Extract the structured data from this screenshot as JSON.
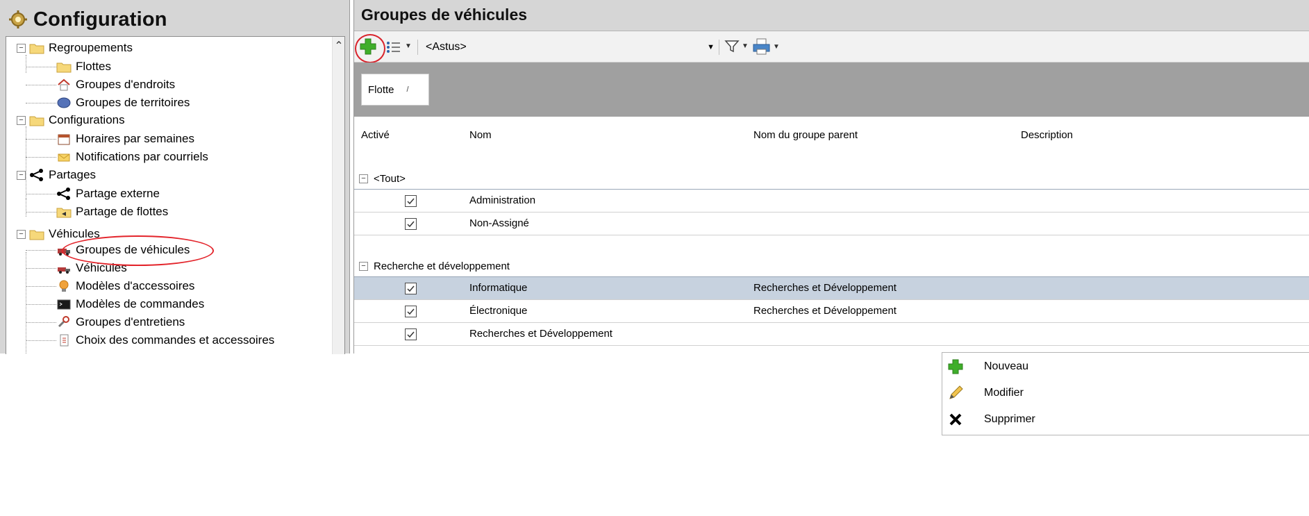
{
  "left": {
    "title": "Configuration",
    "tree": [
      {
        "label": "Regroupements",
        "icon": "folder-icon"
      },
      {
        "label": "Flottes",
        "icon": "folder-icon"
      },
      {
        "label": "Groupes d'endroits",
        "icon": "house-icon"
      },
      {
        "label": "Groupes de territoires",
        "icon": "territory-icon"
      },
      {
        "label": "Configurations",
        "icon": "folder-icon"
      },
      {
        "label": "Horaires par semaines",
        "icon": "calendar-icon"
      },
      {
        "label": "Notifications par courriels",
        "icon": "envelope-icon"
      },
      {
        "label": "Partages",
        "icon": "share-icon"
      },
      {
        "label": "Partage externe",
        "icon": "share-icon"
      },
      {
        "label": "Partage de flottes",
        "icon": "folder-share-icon"
      },
      {
        "label": "Véhicules",
        "icon": "folder-icon"
      },
      {
        "label": "Groupes de véhicules",
        "icon": "vehicle-group-icon"
      },
      {
        "label": "Véhicules",
        "icon": "truck-icon"
      },
      {
        "label": "Modèles d'accessoires",
        "icon": "bulb-icon"
      },
      {
        "label": "Modèles de commandes",
        "icon": "terminal-icon"
      },
      {
        "label": "Groupes d'entretiens",
        "icon": "wrench-icon"
      },
      {
        "label": "Choix des commandes et accessoires",
        "icon": "document-icon"
      }
    ]
  },
  "right": {
    "title": "Groupes de véhicules",
    "toolbar": {
      "selector_value": "<Astus>"
    },
    "group_chip": "Flotte",
    "columns": [
      "Activé",
      "Nom",
      "Nom du groupe parent",
      "Description"
    ],
    "groups": [
      {
        "label": "<Tout>",
        "rows": [
          {
            "active": true,
            "name": "Administration",
            "parent": ""
          },
          {
            "active": true,
            "name": "Non-Assigné",
            "parent": ""
          }
        ]
      },
      {
        "label": "Recherche et développement",
        "rows": [
          {
            "active": true,
            "name": "Informatique",
            "parent": "Recherches et Développement",
            "selected": true
          },
          {
            "active": true,
            "name": "Électronique",
            "parent": "Recherches et Développement"
          },
          {
            "active": true,
            "name": "Recherches et Développement",
            "parent": ""
          }
        ]
      }
    ]
  },
  "context_menu": {
    "items": [
      {
        "label": "Nouveau",
        "icon": "plus-icon"
      },
      {
        "label": "Modifier",
        "icon": "pencil-icon"
      },
      {
        "label": "Supprimer",
        "icon": "delete-icon"
      }
    ]
  },
  "colors": {
    "panel_header": "#d6d6d6",
    "selection": "#c7d2df",
    "highlight": "#e3242b",
    "plus_green": "#3fae2a"
  }
}
